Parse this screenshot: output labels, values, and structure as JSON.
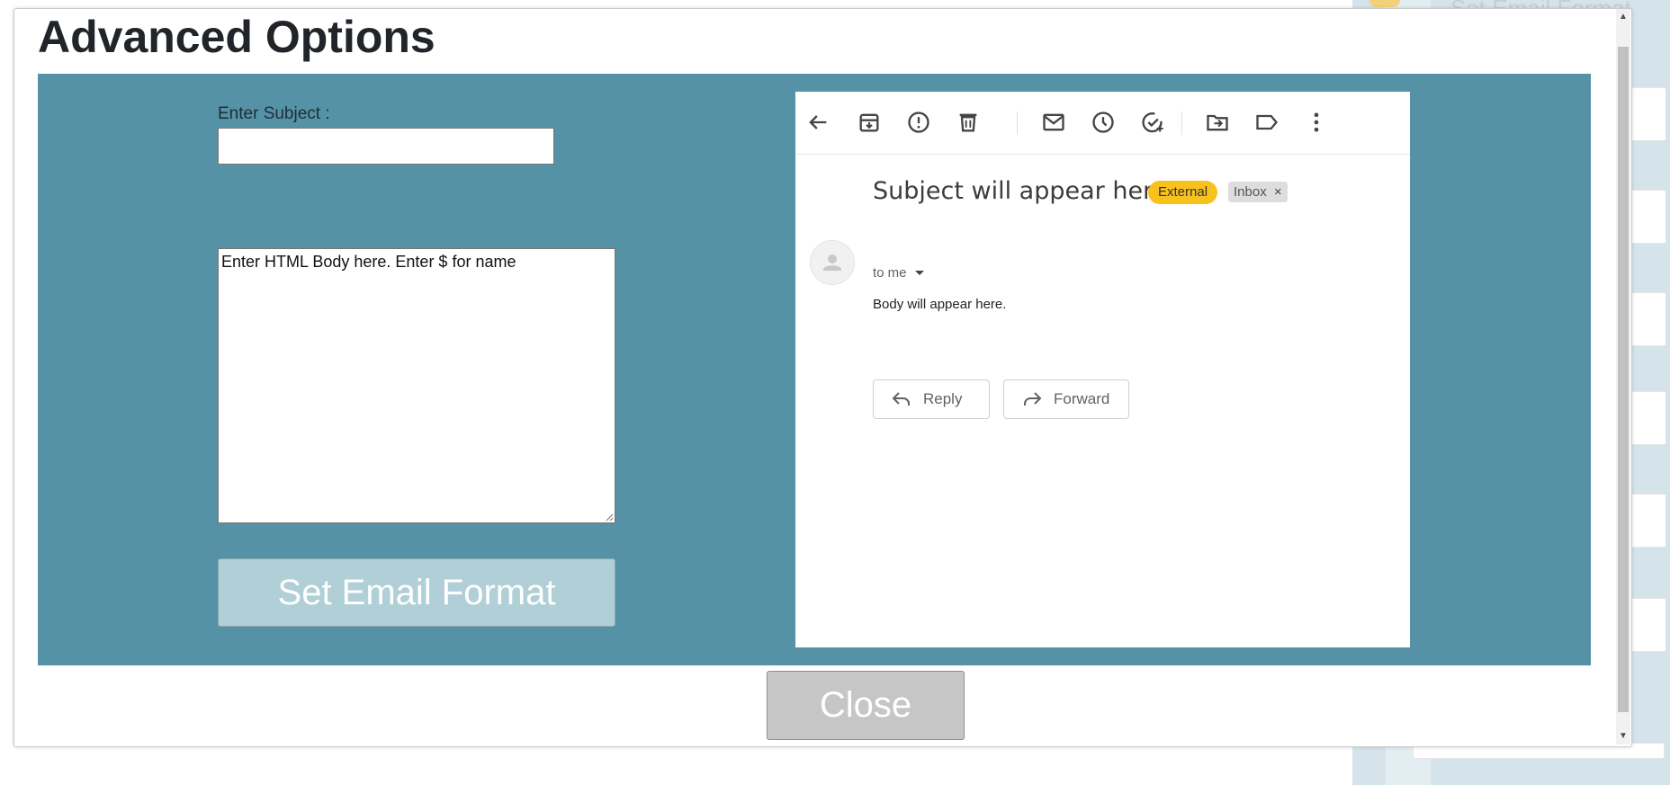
{
  "background": {
    "title": "Set Email Format"
  },
  "modal": {
    "title": "Advanced Options",
    "subject_label": "Enter Subject :",
    "subject_value": "",
    "body_placeholder": "Enter HTML Body here. Enter $ for name",
    "set_button": "Set Email Format",
    "close_button": "Close"
  },
  "preview": {
    "subject": "Subject will appear here",
    "badge_external": "External",
    "badge_inbox": "Inbox",
    "badge_inbox_close": "×",
    "recipient": "to me",
    "body": "Body will appear here.",
    "reply_label": "Reply",
    "forward_label": "Forward",
    "toolbar_icons": [
      "back-arrow-icon",
      "archive-icon",
      "report-spam-icon",
      "delete-icon",
      "mark-unread-icon",
      "snooze-icon",
      "add-task-icon",
      "move-to-icon",
      "label-icon",
      "more-icon"
    ]
  },
  "colors": {
    "panel": "#5592a6",
    "set_button": "#b0cfd6",
    "close_button": "#c6c6c6",
    "external_badge": "#f8c21c"
  }
}
